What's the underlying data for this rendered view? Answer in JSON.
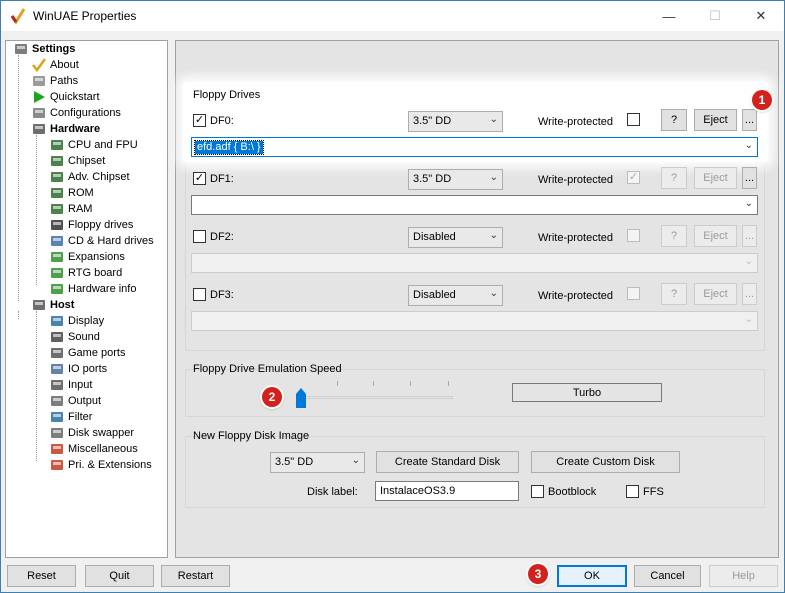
{
  "window": {
    "title": "WinUAE Properties",
    "minimize": "—",
    "maximize": "☐",
    "close": "✕"
  },
  "tree": {
    "items": [
      {
        "label": "Settings",
        "icon": "settings-icon"
      },
      {
        "label": "About",
        "icon": "checkmark-icon"
      },
      {
        "label": "Paths",
        "icon": "paths-icon"
      },
      {
        "label": "Quickstart",
        "icon": "play-icon"
      },
      {
        "label": "Configurations",
        "icon": "config-icon"
      },
      {
        "label": "Hardware",
        "icon": "hardware-icon"
      },
      {
        "label": "CPU and FPU",
        "icon": "chip-icon"
      },
      {
        "label": "Chipset",
        "icon": "chip-icon"
      },
      {
        "label": "Adv. Chipset",
        "icon": "chip-icon"
      },
      {
        "label": "ROM",
        "icon": "chip-icon"
      },
      {
        "label": "RAM",
        "icon": "chip-icon"
      },
      {
        "label": "Floppy drives",
        "icon": "floppy-icon"
      },
      {
        "label": "CD & Hard drives",
        "icon": "disk-icon"
      },
      {
        "label": "Expansions",
        "icon": "board-icon"
      },
      {
        "label": "RTG board",
        "icon": "board-icon"
      },
      {
        "label": "Hardware info",
        "icon": "board-icon"
      },
      {
        "label": "Host",
        "icon": "host-icon"
      },
      {
        "label": "Display",
        "icon": "monitor-icon"
      },
      {
        "label": "Sound",
        "icon": "speaker-icon"
      },
      {
        "label": "Game ports",
        "icon": "joystick-icon"
      },
      {
        "label": "IO ports",
        "icon": "port-icon"
      },
      {
        "label": "Input",
        "icon": "joystick-icon"
      },
      {
        "label": "Output",
        "icon": "output-icon"
      },
      {
        "label": "Filter",
        "icon": "monitor-icon"
      },
      {
        "label": "Disk swapper",
        "icon": "swapper-icon"
      },
      {
        "label": "Miscellaneous",
        "icon": "misc-icon"
      },
      {
        "label": "Pri. & Extensions",
        "icon": "misc-icon"
      }
    ]
  },
  "floppy": {
    "group_title": "Floppy Drives",
    "write_protected_label": "Write-protected",
    "help_label": "?",
    "eject_label": "Eject",
    "browse_label": "...",
    "drives": [
      {
        "name": "DF0:",
        "checked": true,
        "type": "3.5\" DD",
        "image": "efd.adf { B:\\ }"
      },
      {
        "name": "DF1:",
        "checked": true,
        "type": "3.5\" DD",
        "image": ""
      },
      {
        "name": "DF2:",
        "checked": false,
        "type": "Disabled",
        "image": ""
      },
      {
        "name": "DF3:",
        "checked": false,
        "type": "Disabled",
        "image": ""
      }
    ],
    "check_mark": "✓",
    "arrow": "⌄"
  },
  "speed": {
    "group_title": "Floppy Drive Emulation Speed",
    "turbo_label": "Turbo",
    "slider_level": 0
  },
  "new_disk": {
    "group_title": "New Floppy Disk Image",
    "type": "3.5\" DD",
    "create_standard": "Create Standard Disk",
    "create_custom": "Create Custom Disk",
    "disk_label_caption": "Disk label:",
    "disk_label_value": "InstalaceOS3.9",
    "bootblock_label": "Bootblock",
    "ffs_label": "FFS"
  },
  "footer": {
    "reset": "Reset",
    "quit": "Quit",
    "restart": "Restart",
    "ok": "OK",
    "cancel": "Cancel",
    "help": "Help"
  },
  "badges": [
    "1",
    "2",
    "3"
  ],
  "colors": {
    "accent": "#0078d7",
    "badge": "#d3221d"
  }
}
